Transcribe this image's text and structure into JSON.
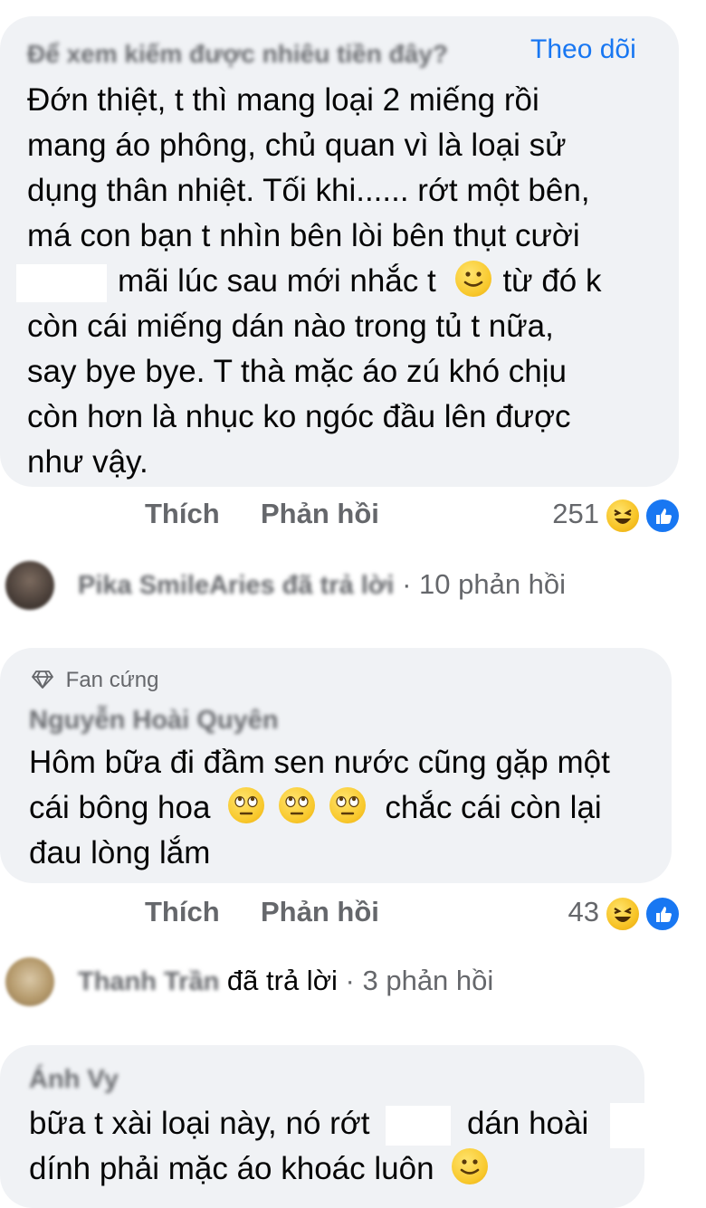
{
  "comment1": {
    "author_blurred": "Để xem kiếm được nhiêu tiền đây?",
    "follow_label": "Theo dõi",
    "lines": [
      "Đớn thiệt, t thì mang loại 2 miếng rồi",
      "mang áo phông, chủ quan vì là loại sử",
      "dụng thân nhiệt. Tối khi...... rớt một bên,",
      "má con bạn t nhìn bên lòi bên thụt cười",
      "mãi lúc sau mới nhắc t",
      "từ đó k",
      "còn cái miếng dán nào trong tủ t nữa,",
      "say bye bye. T thà mặc áo zú khó chịu",
      "còn hơn là nhục ko ngóc đầu lên được",
      "như vậy."
    ],
    "like_label": "Thích",
    "reply_label": "Phản hồi",
    "reaction_count": "251"
  },
  "thread1": {
    "name_blurred": "Pika SmileAries đã trả lời",
    "replies_text": "· 10 phản hồi"
  },
  "comment2": {
    "badge_label": "Fan cứng",
    "author_blurred": "Nguyễn Hoài Quyên",
    "line1": "Hôm bữa đi đầm sen nước cũng gặp một",
    "line2a": "cái bông hoa",
    "line2b": "chắc cái còn lại",
    "line3": "đau lòng lắm",
    "like_label": "Thích",
    "reply_label": "Phản hồi",
    "reaction_count": "43"
  },
  "thread2": {
    "name_blurred": "Thanh Trần",
    "replied_label": "đã trả lời",
    "replies_text": "· 3 phản hồi"
  },
  "comment3": {
    "author_blurred": "Ánh Vy",
    "line1a": "bữa t xài loại này, nó rớt",
    "line1b": "dán hoài",
    "line2": "dính phải mặc áo khoác luôn"
  },
  "colors": {
    "bubble_bg": "#f0f2f5",
    "follow_blue": "#1877f2",
    "meta_gray": "#65676b",
    "text": "#050505"
  },
  "icons": [
    "haha-reaction-icon",
    "like-reaction-icon",
    "smile-emoji-icon",
    "eye-roll-emoji-icon",
    "diamond-badge-icon"
  ]
}
